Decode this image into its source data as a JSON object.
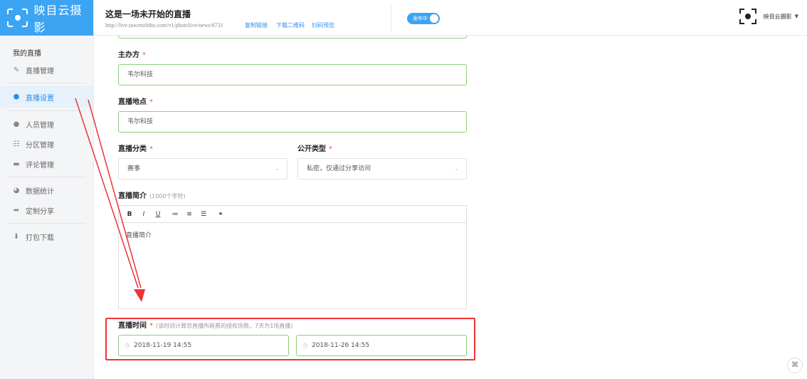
{
  "app": {
    "logo_text": "映目云摄影",
    "accent": "#3ba4f3"
  },
  "sidebar": {
    "section_title": "我的直播",
    "items": [
      {
        "label": "直播管理",
        "icon": "pen-icon"
      },
      {
        "label": "直播设置",
        "icon": "settings-icon",
        "active": true
      },
      {
        "label": "人员管理",
        "icon": "user-icon"
      },
      {
        "label": "分区管理",
        "icon": "grid-list-icon"
      },
      {
        "label": "评论管理",
        "icon": "comment-icon"
      },
      {
        "label": "数据统计",
        "icon": "pie-chart-icon"
      },
      {
        "label": "定制分享",
        "icon": "share-icon"
      },
      {
        "label": "打包下载",
        "icon": "download-icon"
      }
    ]
  },
  "header": {
    "title": "这是一场未开始的直播",
    "url": "http://live.tuwenzhibo.com/v1/photolive/news/6731",
    "links": [
      "复制链接",
      "下载二维码",
      "扫码预览"
    ],
    "publish_toggle": "发布中",
    "user_name": "映目云摄影"
  },
  "form": {
    "organizer": {
      "label": "主办方",
      "required": "*",
      "value": "韦尔科技"
    },
    "location": {
      "label": "直播地点",
      "required": "*",
      "value": "韦尔科技"
    },
    "category": {
      "label": "直播分类",
      "required": "*",
      "value": "赛事"
    },
    "visibility": {
      "label": "公开类型",
      "required": "*",
      "value": "私密，仅通过分享访问"
    },
    "intro": {
      "label": "直播简介",
      "hint": "(1000个字符)",
      "placeholder": "直播简介"
    },
    "toolbar": [
      "B",
      "I",
      "U",
      "≔",
      "≡",
      "☰",
      "⚭"
    ],
    "time": {
      "label": "直播时间",
      "required": "*",
      "hint": "(该时间计算您直播所耗费的授权场数，7天为1场直播)",
      "start": "2018-11-19 14:55",
      "end": "2018-11-26 14:55"
    }
  },
  "corner_button": "⌘"
}
